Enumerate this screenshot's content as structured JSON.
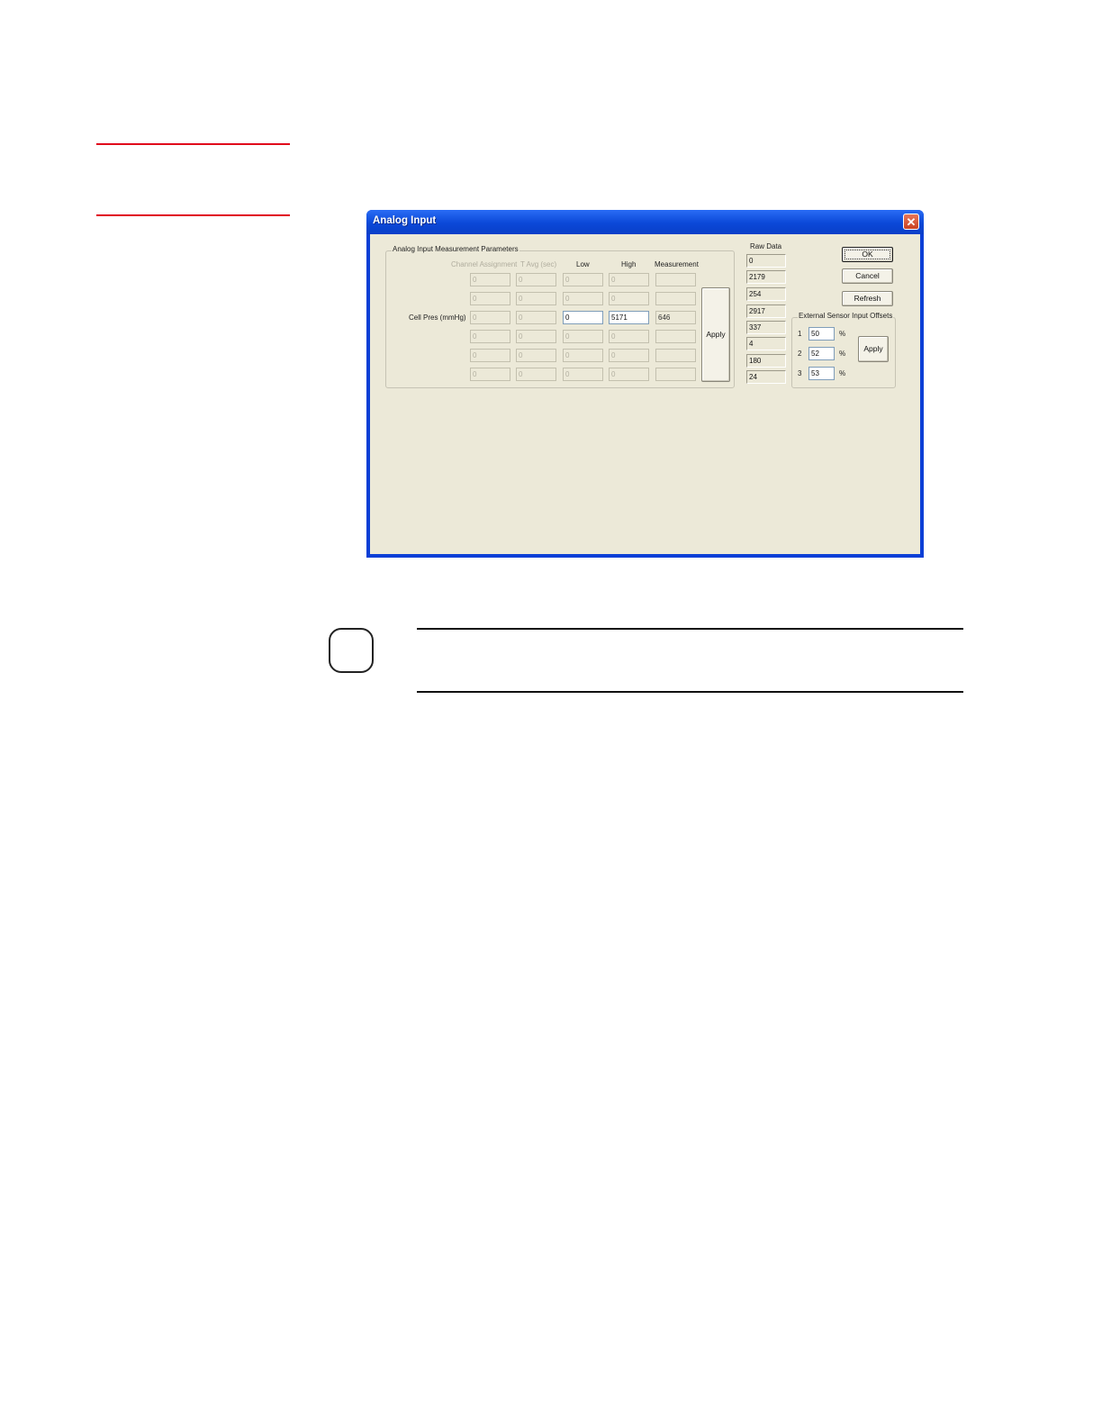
{
  "window": {
    "title": "Analog Input"
  },
  "params_group": {
    "label": "Analog Input Measurement Parameters",
    "columns": [
      "Channel Assignment",
      "T Avg (sec)",
      "Low",
      "High",
      "Measurement"
    ],
    "rows": [
      {
        "label": "",
        "channel": "0",
        "tavg": "0",
        "low": "0",
        "high": "0",
        "measurement": ""
      },
      {
        "label": "",
        "channel": "0",
        "tavg": "0",
        "low": "0",
        "high": "0",
        "measurement": ""
      },
      {
        "label": "Cell Pres (mmHg)",
        "channel": "0",
        "tavg": "0",
        "low": "0",
        "high": "5171",
        "measurement": "646"
      },
      {
        "label": "",
        "channel": "0",
        "tavg": "0",
        "low": "0",
        "high": "0",
        "measurement": ""
      },
      {
        "label": "",
        "channel": "0",
        "tavg": "0",
        "low": "0",
        "high": "0",
        "measurement": ""
      },
      {
        "label": "",
        "channel": "0",
        "tavg": "0",
        "low": "0",
        "high": "0",
        "measurement": ""
      }
    ],
    "apply_label": "Apply"
  },
  "raw_data": {
    "label": "Raw Data",
    "values": [
      "0",
      "2179",
      "254",
      "2917",
      "337",
      "4",
      "180",
      "24"
    ]
  },
  "buttons": {
    "ok": "OK",
    "cancel": "Cancel",
    "refresh": "Refresh"
  },
  "offsets_group": {
    "label": "External Sensor Input Offsets",
    "rows": [
      {
        "index": "1",
        "value": "50",
        "unit": "%"
      },
      {
        "index": "2",
        "value": "52",
        "unit": "%"
      },
      {
        "index": "3",
        "value": "53",
        "unit": "%"
      }
    ],
    "apply_label": "Apply"
  }
}
